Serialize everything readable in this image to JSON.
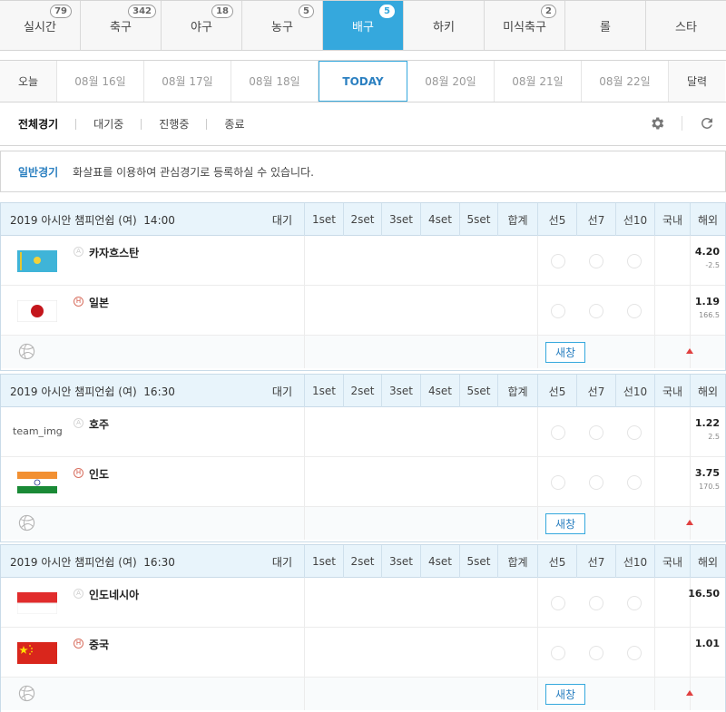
{
  "sport_tabs": [
    {
      "label": "실시간",
      "count": "79"
    },
    {
      "label": "축구",
      "count": "342"
    },
    {
      "label": "야구",
      "count": "18"
    },
    {
      "label": "농구",
      "count": "5"
    },
    {
      "label": "배구",
      "count": "5",
      "active": true
    },
    {
      "label": "하키",
      "count": ""
    },
    {
      "label": "미식축구",
      "count": "2"
    },
    {
      "label": "롤",
      "count": ""
    },
    {
      "label": "스타",
      "count": ""
    }
  ],
  "dates": {
    "today_link": "오늘",
    "items": [
      "08월 16일",
      "08월 17일",
      "08월 18일",
      "TODAY",
      "08월 20일",
      "08월 21일",
      "08월 22일"
    ],
    "calendar": "달력"
  },
  "filters": [
    "전체경기",
    "대기중",
    "진행중",
    "종료"
  ],
  "notice": {
    "tag": "일반경기",
    "message": "화살표를 이용하여 관심경기로 등록하실 수 있습니다."
  },
  "columns": [
    "1set",
    "2set",
    "3set",
    "4set",
    "5set",
    "합계",
    "선5",
    "선7",
    "선10",
    "국내",
    "해외"
  ],
  "home_mark": "H",
  "away_mark": "A",
  "popup_label": "새창",
  "matches": [
    {
      "league": "2019 아시안 챔피언쉽 (여)  14:00",
      "status": "대기",
      "teams": [
        {
          "name": "카자흐스탄",
          "flag": "kazakhstan",
          "side": "away",
          "odd": "4.20",
          "sub": "-2.5"
        },
        {
          "name": "일본",
          "flag": "japan",
          "side": "home",
          "odd": "1.19",
          "sub": "166.5"
        }
      ]
    },
    {
      "league": "2019 아시안 챔피언쉽 (여)  16:30",
      "status": "대기",
      "teams": [
        {
          "name": "호주",
          "flag": "none",
          "img_alt": "team_img",
          "side": "away",
          "odd": "1.22",
          "sub": "2.5"
        },
        {
          "name": "인도",
          "flag": "india",
          "side": "home",
          "odd": "3.75",
          "sub": "170.5"
        }
      ]
    },
    {
      "league": "2019 아시안 챔피언쉽 (여)  16:30",
      "status": "대기",
      "teams": [
        {
          "name": "인도네시아",
          "flag": "indonesia",
          "side": "away",
          "odd": "16.50",
          "sub": ""
        },
        {
          "name": "중국",
          "flag": "china",
          "side": "home",
          "odd": "1.01",
          "sub": ""
        }
      ]
    }
  ],
  "colors": {
    "accent": "#35a8dd",
    "header_bg": "#e8f4fb",
    "favorite_arrow": "#e04040"
  }
}
